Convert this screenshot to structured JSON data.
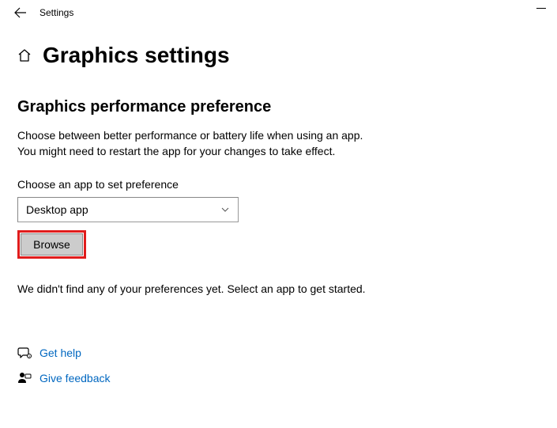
{
  "titlebar": {
    "text": "Settings"
  },
  "header": {
    "title": "Graphics settings"
  },
  "section": {
    "title": "Graphics performance preference",
    "description_line1": "Choose between better performance or battery life when using an app.",
    "description_line2": "You might need to restart the app for your changes to take effect.",
    "field_label": "Choose an app to set preference",
    "select_value": "Desktop app",
    "browse_label": "Browse",
    "empty_message": "We didn't find any of your preferences yet. Select an app to get started."
  },
  "links": {
    "help": "Get help",
    "feedback": "Give feedback"
  }
}
